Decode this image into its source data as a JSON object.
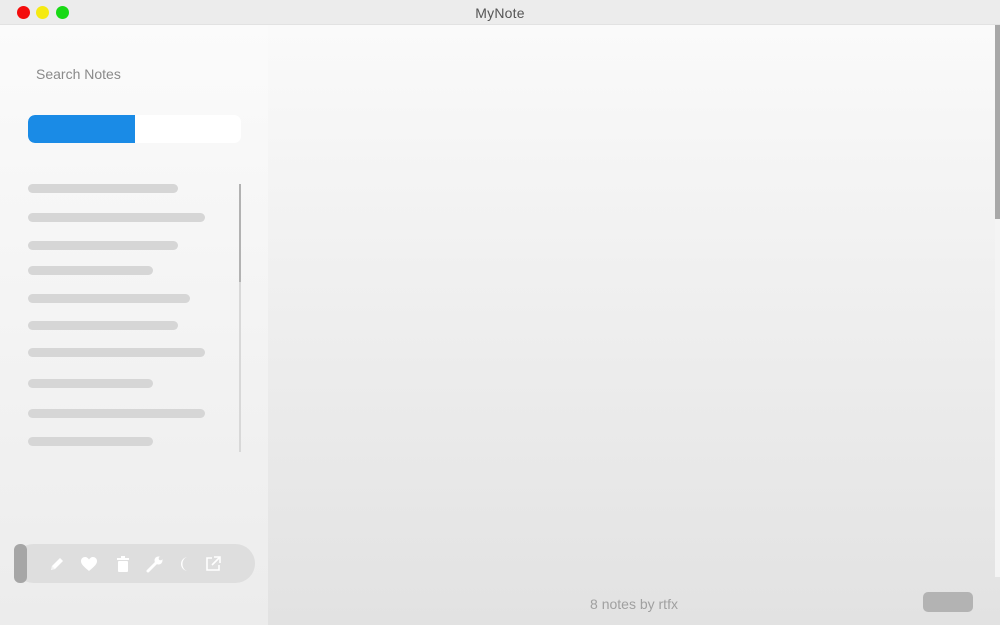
{
  "window": {
    "title": "MyNote",
    "controls": [
      {
        "name": "close",
        "color": "#f40c0c"
      },
      {
        "name": "minimize",
        "color": "#f5ea12"
      },
      {
        "name": "zoom",
        "color": "#19d915"
      }
    ]
  },
  "sidebar": {
    "search": {
      "placeholder": "Search Notes",
      "value": ""
    },
    "progress": {
      "fraction": 0.5,
      "fill_color": "#1a8be6",
      "track_color": "#ffffff"
    },
    "notes_placeholder_count": 10,
    "toolbar": {
      "buttons": [
        {
          "name": "new-note",
          "icon": "pencil-icon"
        },
        {
          "name": "favorite",
          "icon": "heart-icon"
        },
        {
          "name": "delete",
          "icon": "trash-icon"
        },
        {
          "name": "settings",
          "icon": "wrench-icon"
        },
        {
          "name": "night-mode",
          "icon": "moon-icon"
        },
        {
          "name": "export",
          "icon": "external-link-icon"
        }
      ]
    }
  },
  "main": {
    "status": "8 notes by rtfx"
  }
}
